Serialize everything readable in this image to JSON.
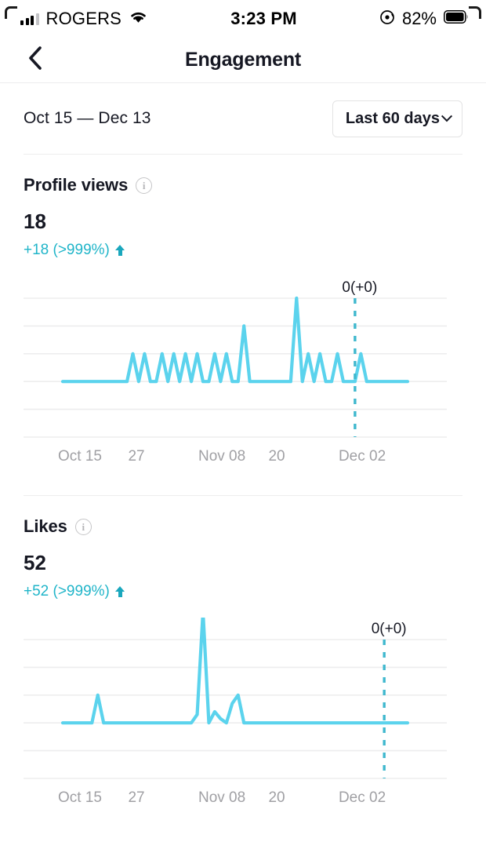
{
  "status_bar": {
    "carrier": "ROGERS",
    "signal_icon": "signal-bars-icon",
    "wifi_icon": "wifi-icon",
    "time": "3:23 PM",
    "rotation_lock_icon": "rotation-lock-icon",
    "battery_percent": "82%",
    "battery_icon": "battery-icon"
  },
  "nav": {
    "back_icon": "chevron-left-icon",
    "title": "Engagement"
  },
  "filter": {
    "date_range": "Oct 15 — Dec 13",
    "range_button_label": "Last 60 days",
    "range_button_icon": "chevron-down-icon"
  },
  "colors": {
    "accent_line": "#5BD3ED",
    "delta_text": "#20b5c9",
    "dashed_marker": "#3FB8CE",
    "grid": "#ededee",
    "muted_text": "#a0a0a4"
  },
  "metrics": [
    {
      "title": "Profile views",
      "info_icon": "info-icon",
      "value": "18",
      "delta": "+18 (>999%)",
      "delta_direction_icon": "arrow-up-icon"
    },
    {
      "title": "Likes",
      "info_icon": "info-icon",
      "value": "52",
      "delta": "+52 (>999%)",
      "delta_direction_icon": "arrow-up-icon"
    }
  ],
  "chart_data": [
    {
      "type": "line",
      "title": "Profile views",
      "xlabel": "",
      "ylabel": "",
      "ylim": [
        0,
        5
      ],
      "grid": true,
      "gridline_count": 6,
      "legend": "none",
      "marker_label": "0(+0)",
      "marker_x_index": 50,
      "x_tick_labels": [
        "Oct 15",
        "27",
        "Nov 08",
        "20",
        "Dec 02"
      ],
      "x_tick_indices": [
        0,
        12,
        24,
        36,
        48
      ],
      "x": [
        "Oct 15",
        "Oct 16",
        "Oct 17",
        "Oct 18",
        "Oct 19",
        "Oct 20",
        "Oct 21",
        "Oct 22",
        "Oct 23",
        "Oct 24",
        "Oct 25",
        "Oct 26",
        "Oct 27",
        "Oct 28",
        "Oct 29",
        "Oct 30",
        "Oct 31",
        "Nov 01",
        "Nov 02",
        "Nov 03",
        "Nov 04",
        "Nov 05",
        "Nov 06",
        "Nov 07",
        "Nov 08",
        "Nov 09",
        "Nov 10",
        "Nov 11",
        "Nov 12",
        "Nov 13",
        "Nov 14",
        "Nov 15",
        "Nov 16",
        "Nov 17",
        "Nov 18",
        "Nov 19",
        "Nov 20",
        "Nov 21",
        "Nov 22",
        "Nov 23",
        "Nov 24",
        "Nov 25",
        "Nov 26",
        "Nov 27",
        "Nov 28",
        "Nov 29",
        "Nov 30",
        "Dec 01",
        "Dec 02",
        "Dec 03",
        "Dec 04",
        "Dec 05",
        "Dec 06",
        "Dec 07",
        "Dec 08",
        "Dec 09",
        "Dec 10",
        "Dec 11",
        "Dec 12",
        "Dec 13"
      ],
      "values": [
        0,
        0,
        0,
        0,
        0,
        0,
        0,
        0,
        0,
        0,
        0,
        0,
        1,
        0,
        1,
        0,
        0,
        1,
        0,
        1,
        0,
        1,
        0,
        1,
        0,
        0,
        1,
        0,
        1,
        0,
        0,
        2,
        0,
        0,
        0,
        0,
        0,
        0,
        0,
        0,
        3,
        0,
        1,
        0,
        1,
        0,
        0,
        1,
        0,
        0,
        0,
        1,
        0,
        0,
        0,
        0,
        0,
        0,
        0,
        0
      ]
    },
    {
      "type": "line",
      "title": "Likes",
      "xlabel": "",
      "ylabel": "",
      "ylim": [
        0,
        5
      ],
      "grid": true,
      "gridline_count": 6,
      "legend": "none",
      "marker_label": "0(+0)",
      "marker_x_index": 55,
      "x_tick_labels": [
        "Oct 15",
        "27",
        "Nov 08",
        "20",
        "Dec 02"
      ],
      "x_tick_indices": [
        0,
        12,
        24,
        36,
        48
      ],
      "x": [
        "Oct 15",
        "Oct 16",
        "Oct 17",
        "Oct 18",
        "Oct 19",
        "Oct 20",
        "Oct 21",
        "Oct 22",
        "Oct 23",
        "Oct 24",
        "Oct 25",
        "Oct 26",
        "Oct 27",
        "Oct 28",
        "Oct 29",
        "Oct 30",
        "Oct 31",
        "Nov 01",
        "Nov 02",
        "Nov 03",
        "Nov 04",
        "Nov 05",
        "Nov 06",
        "Nov 07",
        "Nov 08",
        "Nov 09",
        "Nov 10",
        "Nov 11",
        "Nov 12",
        "Nov 13",
        "Nov 14",
        "Nov 15",
        "Nov 16",
        "Nov 17",
        "Nov 18",
        "Nov 19",
        "Nov 20",
        "Nov 21",
        "Nov 22",
        "Nov 23",
        "Nov 24",
        "Nov 25",
        "Nov 26",
        "Nov 27",
        "Nov 28",
        "Nov 29",
        "Nov 30",
        "Dec 01",
        "Dec 02",
        "Dec 03",
        "Dec 04",
        "Dec 05",
        "Dec 06",
        "Dec 07",
        "Dec 08",
        "Dec 09",
        "Dec 10",
        "Dec 11",
        "Dec 12",
        "Dec 13"
      ],
      "values": [
        0,
        0,
        0,
        0,
        0,
        0,
        1,
        0,
        0,
        0,
        0,
        0,
        0,
        0,
        0,
        0,
        0,
        0,
        0,
        0,
        0,
        0,
        0,
        0.3,
        4,
        0,
        0.4,
        0.15,
        0,
        0.7,
        1,
        0,
        0,
        0,
        0,
        0,
        0,
        0,
        0,
        0,
        0,
        0,
        0,
        0,
        0,
        0,
        0,
        0,
        0,
        0,
        0,
        0,
        0,
        0,
        0,
        0,
        0,
        0,
        0,
        0
      ]
    }
  ]
}
